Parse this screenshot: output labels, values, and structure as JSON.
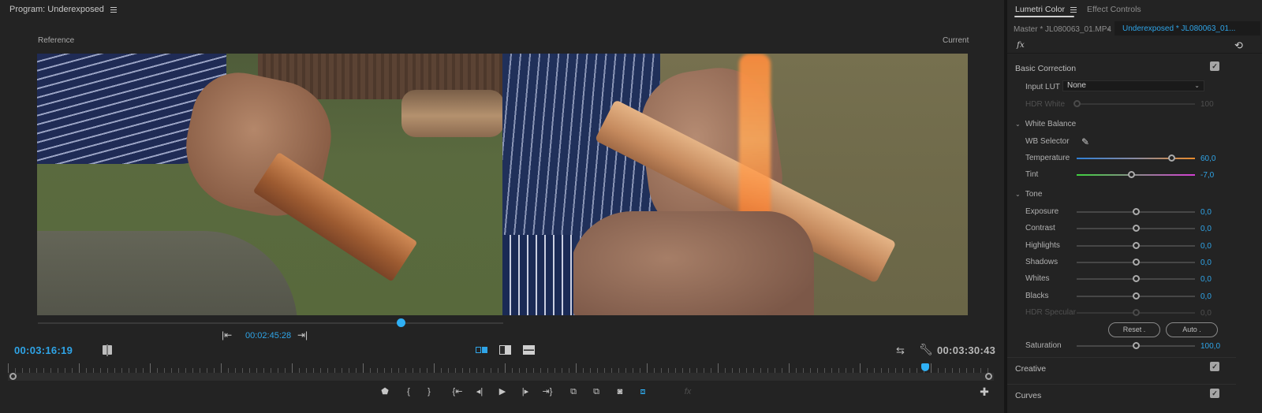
{
  "monitor": {
    "title": "Program: Underexposed",
    "reference_label": "Reference",
    "current_label": "Current",
    "reference_timecode": "00:02:45:28",
    "reference_scrub_position": 0.78,
    "current_timecode": "00:03:16:19",
    "duration_timecode": "00:03:30:43",
    "playhead_position": 0.93,
    "view_modes": [
      {
        "name": "side-by-side",
        "active": true
      },
      {
        "name": "vertical-split",
        "active": false
      },
      {
        "name": "horizontal-split",
        "active": false
      }
    ],
    "transport": [
      {
        "name": "add-marker",
        "glyph": "⬟"
      },
      {
        "name": "mark-in",
        "glyph": "{"
      },
      {
        "name": "mark-out",
        "glyph": "}"
      },
      {
        "name": "go-to-in",
        "glyph": "{⇤"
      },
      {
        "name": "step-back",
        "glyph": "◂|"
      },
      {
        "name": "play",
        "glyph": "▶"
      },
      {
        "name": "step-forward",
        "glyph": "|▸"
      },
      {
        "name": "go-to-out",
        "glyph": "⇥}"
      },
      {
        "name": "lift",
        "glyph": "⧉"
      },
      {
        "name": "extract",
        "glyph": "⧉"
      },
      {
        "name": "export-frame",
        "glyph": "◙"
      },
      {
        "name": "comparison-view",
        "glyph": "⧈"
      },
      {
        "name": "fx-toggle",
        "glyph": "fx"
      },
      {
        "name": "button-editor",
        "glyph": "✚"
      }
    ]
  },
  "lumetri": {
    "tabs": [
      {
        "label": "Lumetri Color",
        "active": true
      },
      {
        "label": "Effect Controls",
        "active": false
      }
    ],
    "master_clip": "Master * JL080063_01.MP4",
    "target_clip": "Underexposed * JL080063_01...",
    "fx_label": "fx",
    "basic_correction": {
      "title": "Basic Correction",
      "enabled": true,
      "input_lut_label": "Input LUT",
      "input_lut_value": "None",
      "hdr_white": {
        "label": "HDR White",
        "value": "100",
        "fraction": 0.0
      },
      "white_balance": {
        "title": "White Balance",
        "wb_selector_label": "WB Selector",
        "temperature": {
          "label": "Temperature",
          "value": "60,0",
          "fraction": 0.8
        },
        "tint": {
          "label": "Tint",
          "value": "-7,0",
          "fraction": 0.46
        }
      },
      "tone": {
        "title": "Tone",
        "rows": [
          {
            "label": "Exposure",
            "value": "0,0",
            "fraction": 0.5,
            "disabled": false
          },
          {
            "label": "Contrast",
            "value": "0,0",
            "fraction": 0.5,
            "disabled": false
          },
          {
            "label": "Highlights",
            "value": "0,0",
            "fraction": 0.5,
            "disabled": false
          },
          {
            "label": "Shadows",
            "value": "0,0",
            "fraction": 0.5,
            "disabled": false
          },
          {
            "label": "Whites",
            "value": "0,0",
            "fraction": 0.5,
            "disabled": false
          },
          {
            "label": "Blacks",
            "value": "0,0",
            "fraction": 0.5,
            "disabled": false
          },
          {
            "label": "HDR Specular",
            "value": "0,0",
            "fraction": 0.5,
            "disabled": true
          }
        ],
        "reset_label": "Reset",
        "auto_label": "Auto"
      },
      "saturation": {
        "label": "Saturation",
        "value": "100,0",
        "fraction": 0.5
      }
    },
    "sections": [
      {
        "title": "Creative",
        "enabled": true
      },
      {
        "title": "Curves",
        "enabled": true
      }
    ]
  },
  "colors": {
    "accent": "#2fa4e7",
    "temperature_cool": "#2f7fd6",
    "temperature_warm": "#e98a2a",
    "tint_green": "#3fd13f",
    "tint_magenta": "#d43fd4"
  }
}
